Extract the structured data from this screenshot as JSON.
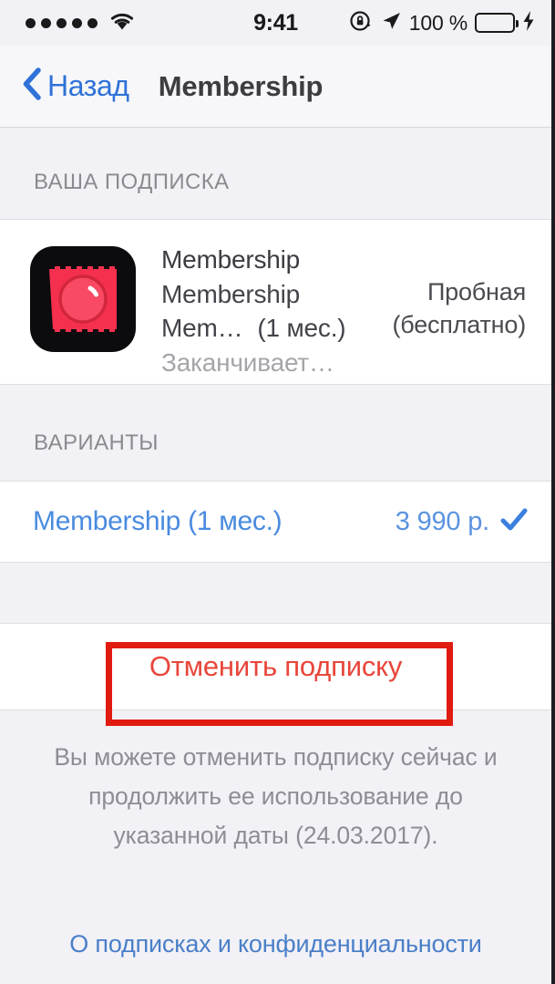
{
  "status_bar": {
    "signal_dots": 5,
    "wifi_icon": "wifi-icon",
    "time": "9:41",
    "rotation_lock_icon": "rotation-lock-icon",
    "location_icon": "location-arrow-icon",
    "battery_percent": "100 %",
    "battery_icon": "battery-icon",
    "charging_icon": "charging-bolt-icon",
    "battery_color": "#ffcc00"
  },
  "nav": {
    "back_label": "Назад",
    "back_icon": "chevron-left-icon",
    "title": "Membership",
    "tint_color": "#2f72d8"
  },
  "subscription_section": {
    "header": "ВАША ПОДПИСКА",
    "item": {
      "icon_name": "membership-app-icon",
      "title": "Membership",
      "subtitle": "Membership",
      "plan": "Mem…",
      "duration": "(1 мес.)",
      "status": "Заканчивает…",
      "price_line1": "Пробная",
      "price_line2": "(бесплатно)"
    }
  },
  "options_section": {
    "header": "ВАРИАНТЫ",
    "items": [
      {
        "label": "Membership (1 мес.)",
        "price": "3 990 р.",
        "selected": true,
        "check_icon": "checkmark-icon"
      }
    ]
  },
  "cancel": {
    "label": "Отменить подписку",
    "color": "#e8463b",
    "annotation_color": "#e01b10"
  },
  "footer": {
    "note": "Вы можете отменить подписку сейчас и продолжить ее использование до указанной даты (24.03.2017).",
    "link": "О подписках и конфиденциальности"
  }
}
